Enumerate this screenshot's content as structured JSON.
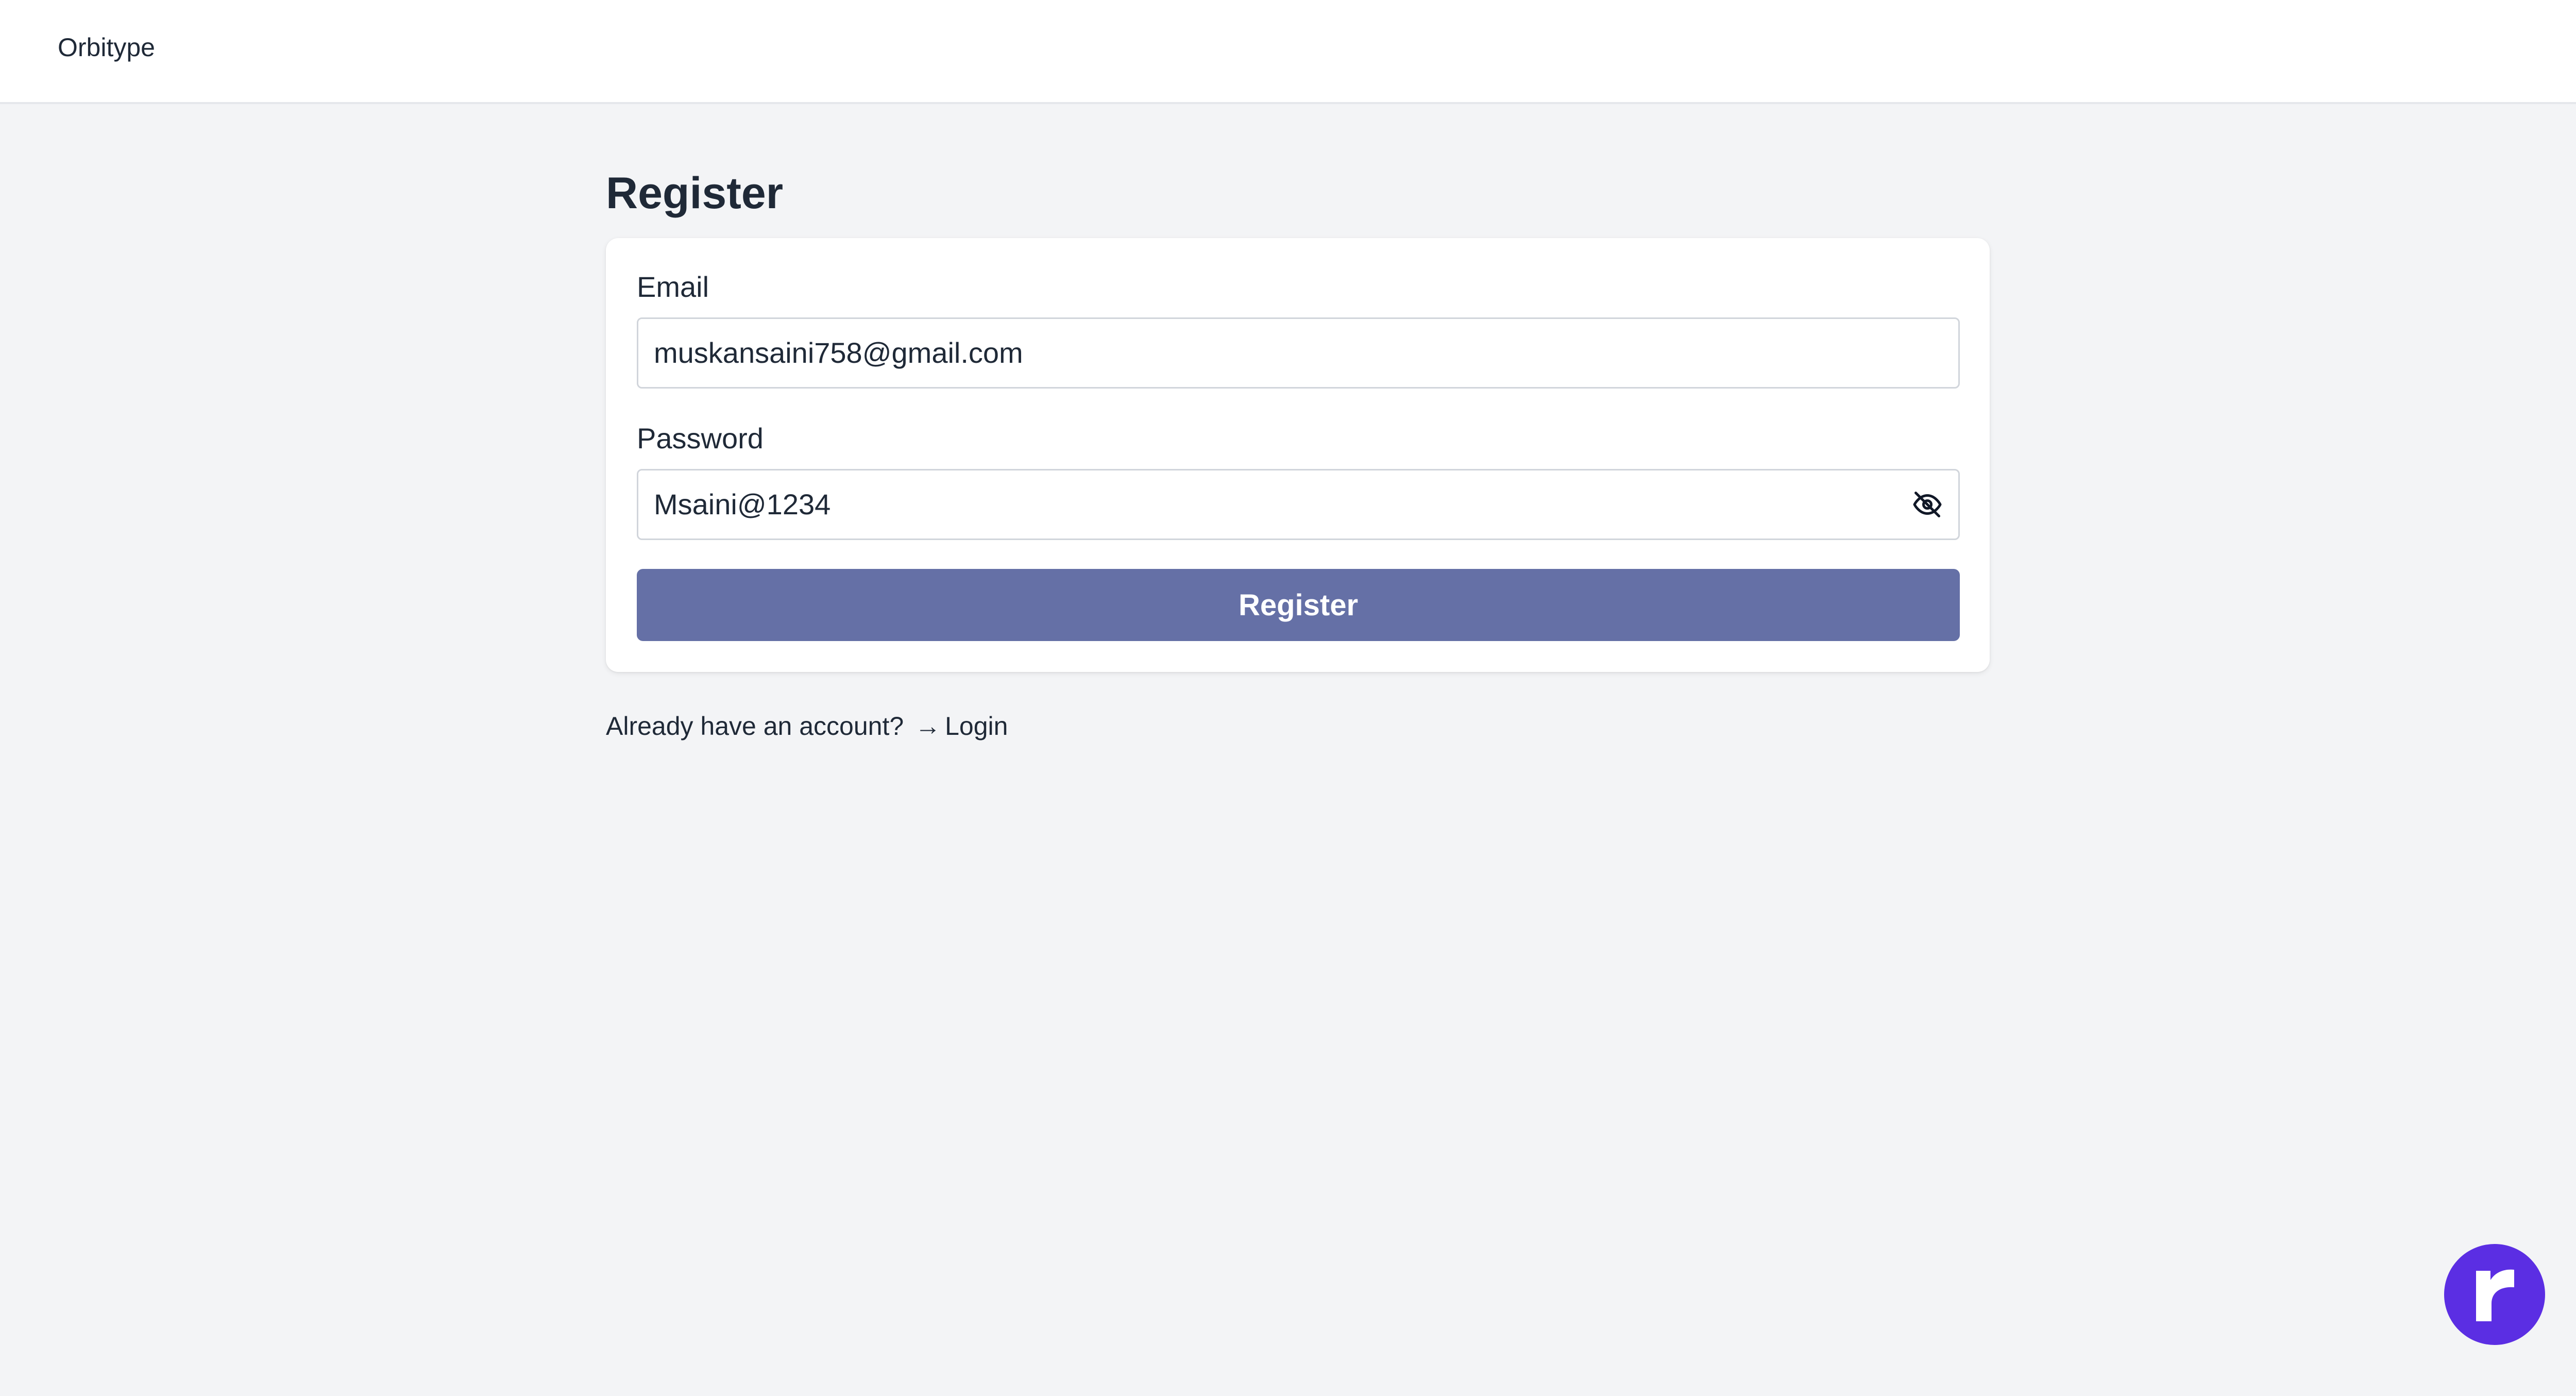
{
  "header": {
    "brand": "Orbitype"
  },
  "page": {
    "title": "Register"
  },
  "form": {
    "email_label": "Email",
    "email_value": "muskansaini758@gmail.com",
    "password_label": "Password",
    "password_value": "Msaini@1234",
    "password_toggle_icon": "eye-off-icon",
    "submit_label": "Register"
  },
  "footer": {
    "prompt": "Already have an account?",
    "arrow": "→",
    "login_label": "Login"
  },
  "floating_button": {
    "icon": "r-logo-icon"
  },
  "colors": {
    "primary_button": "#6570a6",
    "fab": "#5b2ee3"
  }
}
